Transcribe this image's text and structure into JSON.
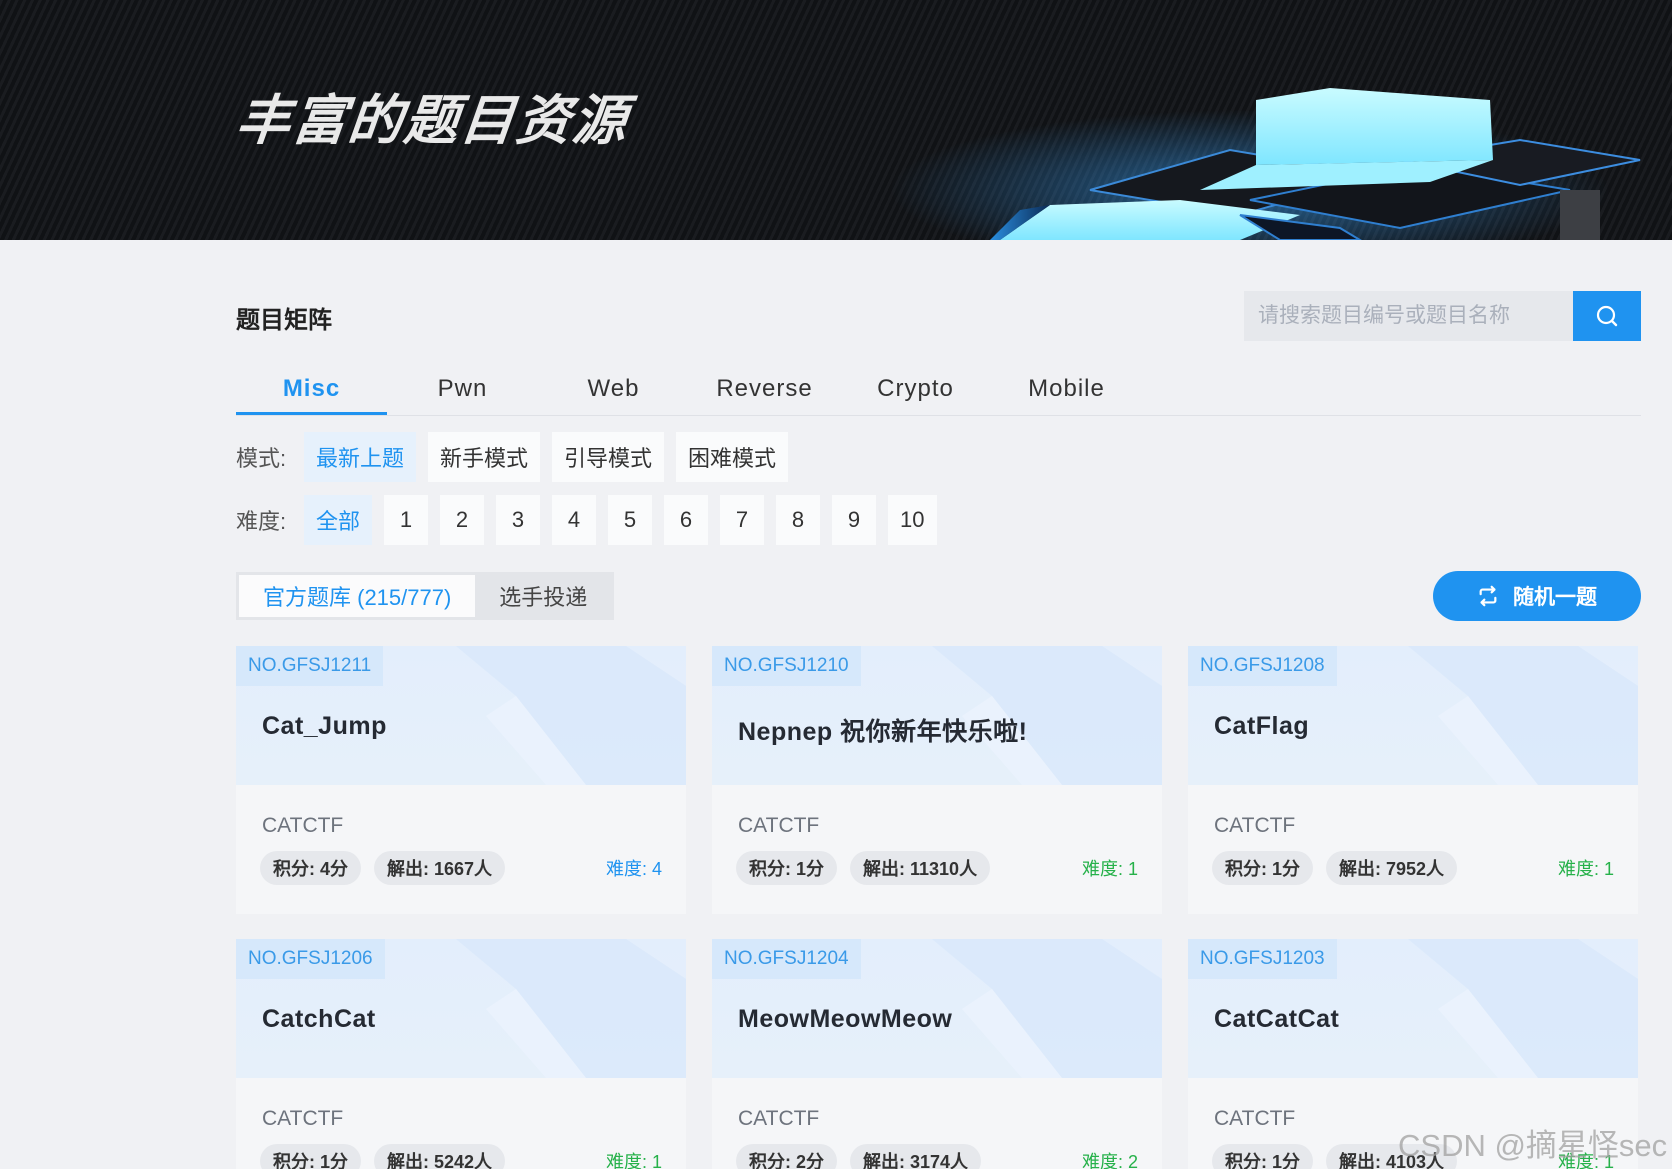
{
  "banner": {
    "title": "丰富的题目资源"
  },
  "section": {
    "title": "题目矩阵"
  },
  "search": {
    "placeholder": "请搜索题目编号或题目名称",
    "icon": "search-icon"
  },
  "tabs": [
    {
      "label": "Misc",
      "active": true
    },
    {
      "label": "Pwn"
    },
    {
      "label": "Web"
    },
    {
      "label": "Reverse"
    },
    {
      "label": "Crypto"
    },
    {
      "label": "Mobile"
    }
  ],
  "mode": {
    "label": "模式:",
    "options": [
      "最新上题",
      "新手模式",
      "引导模式",
      "困难模式"
    ],
    "selected": "最新上题"
  },
  "difficulty": {
    "label": "难度:",
    "options": [
      "全部",
      "1",
      "2",
      "3",
      "4",
      "5",
      "6",
      "7",
      "8",
      "9",
      "10"
    ],
    "selected": "全部"
  },
  "bank": {
    "official": "官方题库 (215/777)",
    "player": "选手投递"
  },
  "random_button": {
    "label": "随机一题",
    "icon": "shuffle-icon"
  },
  "cards": [
    {
      "no": "NO.GFSJ1211",
      "name": "Cat_Jump",
      "org": "CATCTF",
      "score": "积分: 4分",
      "solved": "解出: 1667人",
      "difficulty": "难度: 4",
      "diff_color": "blue"
    },
    {
      "no": "NO.GFSJ1210",
      "name": "Nepnep 祝你新年快乐啦!",
      "org": "CATCTF",
      "score": "积分: 1分",
      "solved": "解出: 11310人",
      "difficulty": "难度: 1",
      "diff_color": "green"
    },
    {
      "no": "NO.GFSJ1208",
      "name": "CatFlag",
      "org": "CATCTF",
      "score": "积分: 1分",
      "solved": "解出: 7952人",
      "difficulty": "难度: 1",
      "diff_color": "green"
    },
    {
      "no": "NO.GFSJ1206",
      "name": "CatchCat",
      "org": "CATCTF",
      "score": "积分: 1分",
      "solved": "解出: 5242人",
      "difficulty": "难度: 1",
      "diff_color": "green"
    },
    {
      "no": "NO.GFSJ1204",
      "name": "MeowMeowMeow",
      "org": "CATCTF",
      "score": "积分: 2分",
      "solved": "解出: 3174人",
      "difficulty": "难度: 2",
      "diff_color": "green"
    },
    {
      "no": "NO.GFSJ1203",
      "name": "CatCatCat",
      "org": "CATCTF",
      "score": "积分: 1分",
      "solved": "解出: 4103人",
      "difficulty": "难度: 1",
      "diff_color": "green"
    }
  ],
  "watermark": "CSDN @摘星怪sec",
  "colors": {
    "accent": "#1f93f0",
    "green": "#26b14a",
    "page_bg": "#f0f1f4"
  }
}
